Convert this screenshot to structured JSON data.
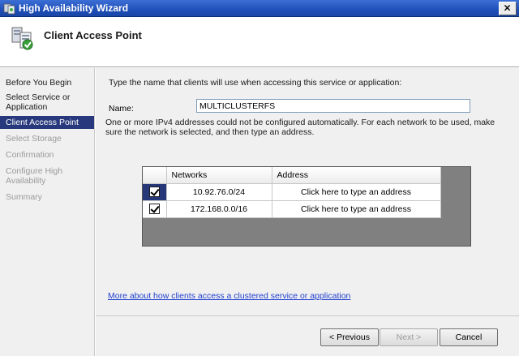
{
  "window": {
    "title": "High Availability Wizard"
  },
  "header": {
    "title": "Client Access Point"
  },
  "sidebar": {
    "items": [
      {
        "label": "Before You Begin",
        "state": "normal"
      },
      {
        "label": "Select Service or Application",
        "state": "normal"
      },
      {
        "label": "Client Access Point",
        "state": "active"
      },
      {
        "label": "Select Storage",
        "state": "disabled"
      },
      {
        "label": "Confirmation",
        "state": "disabled"
      },
      {
        "label": "Configure High Availability",
        "state": "disabled"
      },
      {
        "label": "Summary",
        "state": "disabled"
      }
    ]
  },
  "main": {
    "intro": "Type the name that clients will use when accessing this service or application:",
    "name_label": "Name:",
    "name_value": "MULTICLUSTERFS",
    "note": "One or more IPv4 addresses could not be configured automatically.  For each network to be used, make sure the network is selected, and then type an address.",
    "grid": {
      "columns": [
        "",
        "Networks",
        "Address"
      ],
      "rows": [
        {
          "checked": true,
          "network": "10.92.76.0/24",
          "address": "Click here to type an address"
        },
        {
          "checked": true,
          "network": "172.168.0.0/16",
          "address": "Click here to type an address"
        }
      ]
    },
    "more_link": "More about how clients access a clustered service or application"
  },
  "footer": {
    "prev_label": "< Previous",
    "next_label": "Next >",
    "cancel_label": "Cancel"
  },
  "colors": {
    "titlebar": "#1f4fb8",
    "nav_active": "#27397c",
    "link": "#1f3fcf",
    "grid_background": "#808080"
  }
}
